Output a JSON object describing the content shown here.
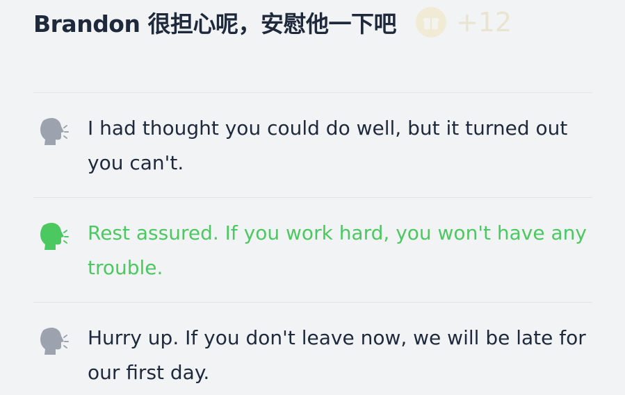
{
  "header": {
    "title": "Brandon 很担心呢，安慰他一下吧",
    "reward_icon": "gift-box-icon",
    "reward_count": "+12"
  },
  "options": [
    {
      "text": "I had thought you could do well, but it turned out you can't.",
      "state": "default",
      "icon": "speaking-head-icon",
      "color": "#9ca3af"
    },
    {
      "text": "Rest assured. If you work hard, you won't have any trouble.",
      "state": "correct",
      "icon": "speaking-head-icon",
      "color": "#4cc860"
    },
    {
      "text": "Hurry up. If you don't leave now, we will be late for our first day.",
      "state": "default",
      "icon": "speaking-head-icon",
      "color": "#9ca3af"
    }
  ],
  "colors": {
    "background": "#f1f3f5",
    "text": "#1e293b",
    "correct": "#4cc860",
    "icon_default": "#9ca3af",
    "divider": "#e2e5e8"
  }
}
